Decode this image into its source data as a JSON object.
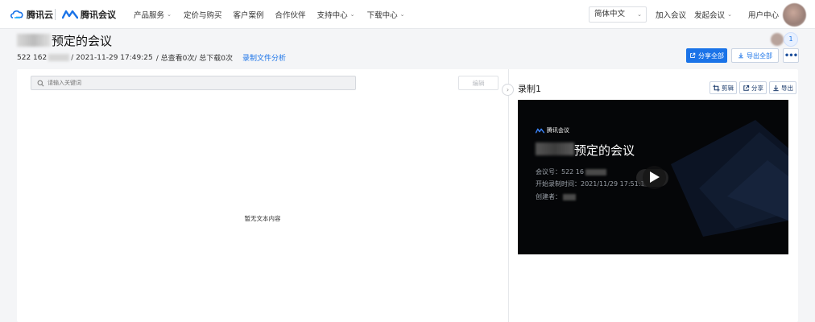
{
  "nav": {
    "brand_cloud": "腾讯云",
    "brand_meeting": "腾讯会议",
    "links": [
      {
        "label": "产品服务",
        "dropdown": true
      },
      {
        "label": "定价与购买",
        "dropdown": false
      },
      {
        "label": "客户案例",
        "dropdown": false
      },
      {
        "label": "合作伙伴",
        "dropdown": false
      },
      {
        "label": "支持中心",
        "dropdown": true
      },
      {
        "label": "下载中心",
        "dropdown": true
      }
    ],
    "language": "简体中文",
    "join_meeting": "加入会议",
    "start_meeting": "发起会议",
    "user_center": "用户中心",
    "caret": "⌄"
  },
  "header": {
    "title": "预定的会议",
    "meeting_id_prefix": "522 162",
    "recorded_at": "/ 2021-11-29 17:49:25",
    "stats": "/ 总查看0次/ 总下载0次",
    "analysis_link": "录制文件分析",
    "viewer_count": "1",
    "share_all": "分享全部",
    "export_all": "导出全部",
    "more": "•••"
  },
  "transcript": {
    "search_placeholder": "请输入关键词",
    "edit_label": "编辑",
    "empty_text": "暂无文本内容",
    "collapse_icon": "›"
  },
  "recording": {
    "title": "录制1",
    "actions": {
      "clip": "剪辑",
      "share": "分享",
      "export": "导出"
    },
    "video": {
      "brand": "腾讯会议",
      "title": "预定的会议",
      "meeting_no_label": "会议号：522 16",
      "start_time_label": "开始录制时间：2021/11/29 17:51:1",
      "creator_label": "创建者："
    }
  },
  "colors": {
    "accent": "#1a73e8",
    "video_bg": "#050608"
  }
}
